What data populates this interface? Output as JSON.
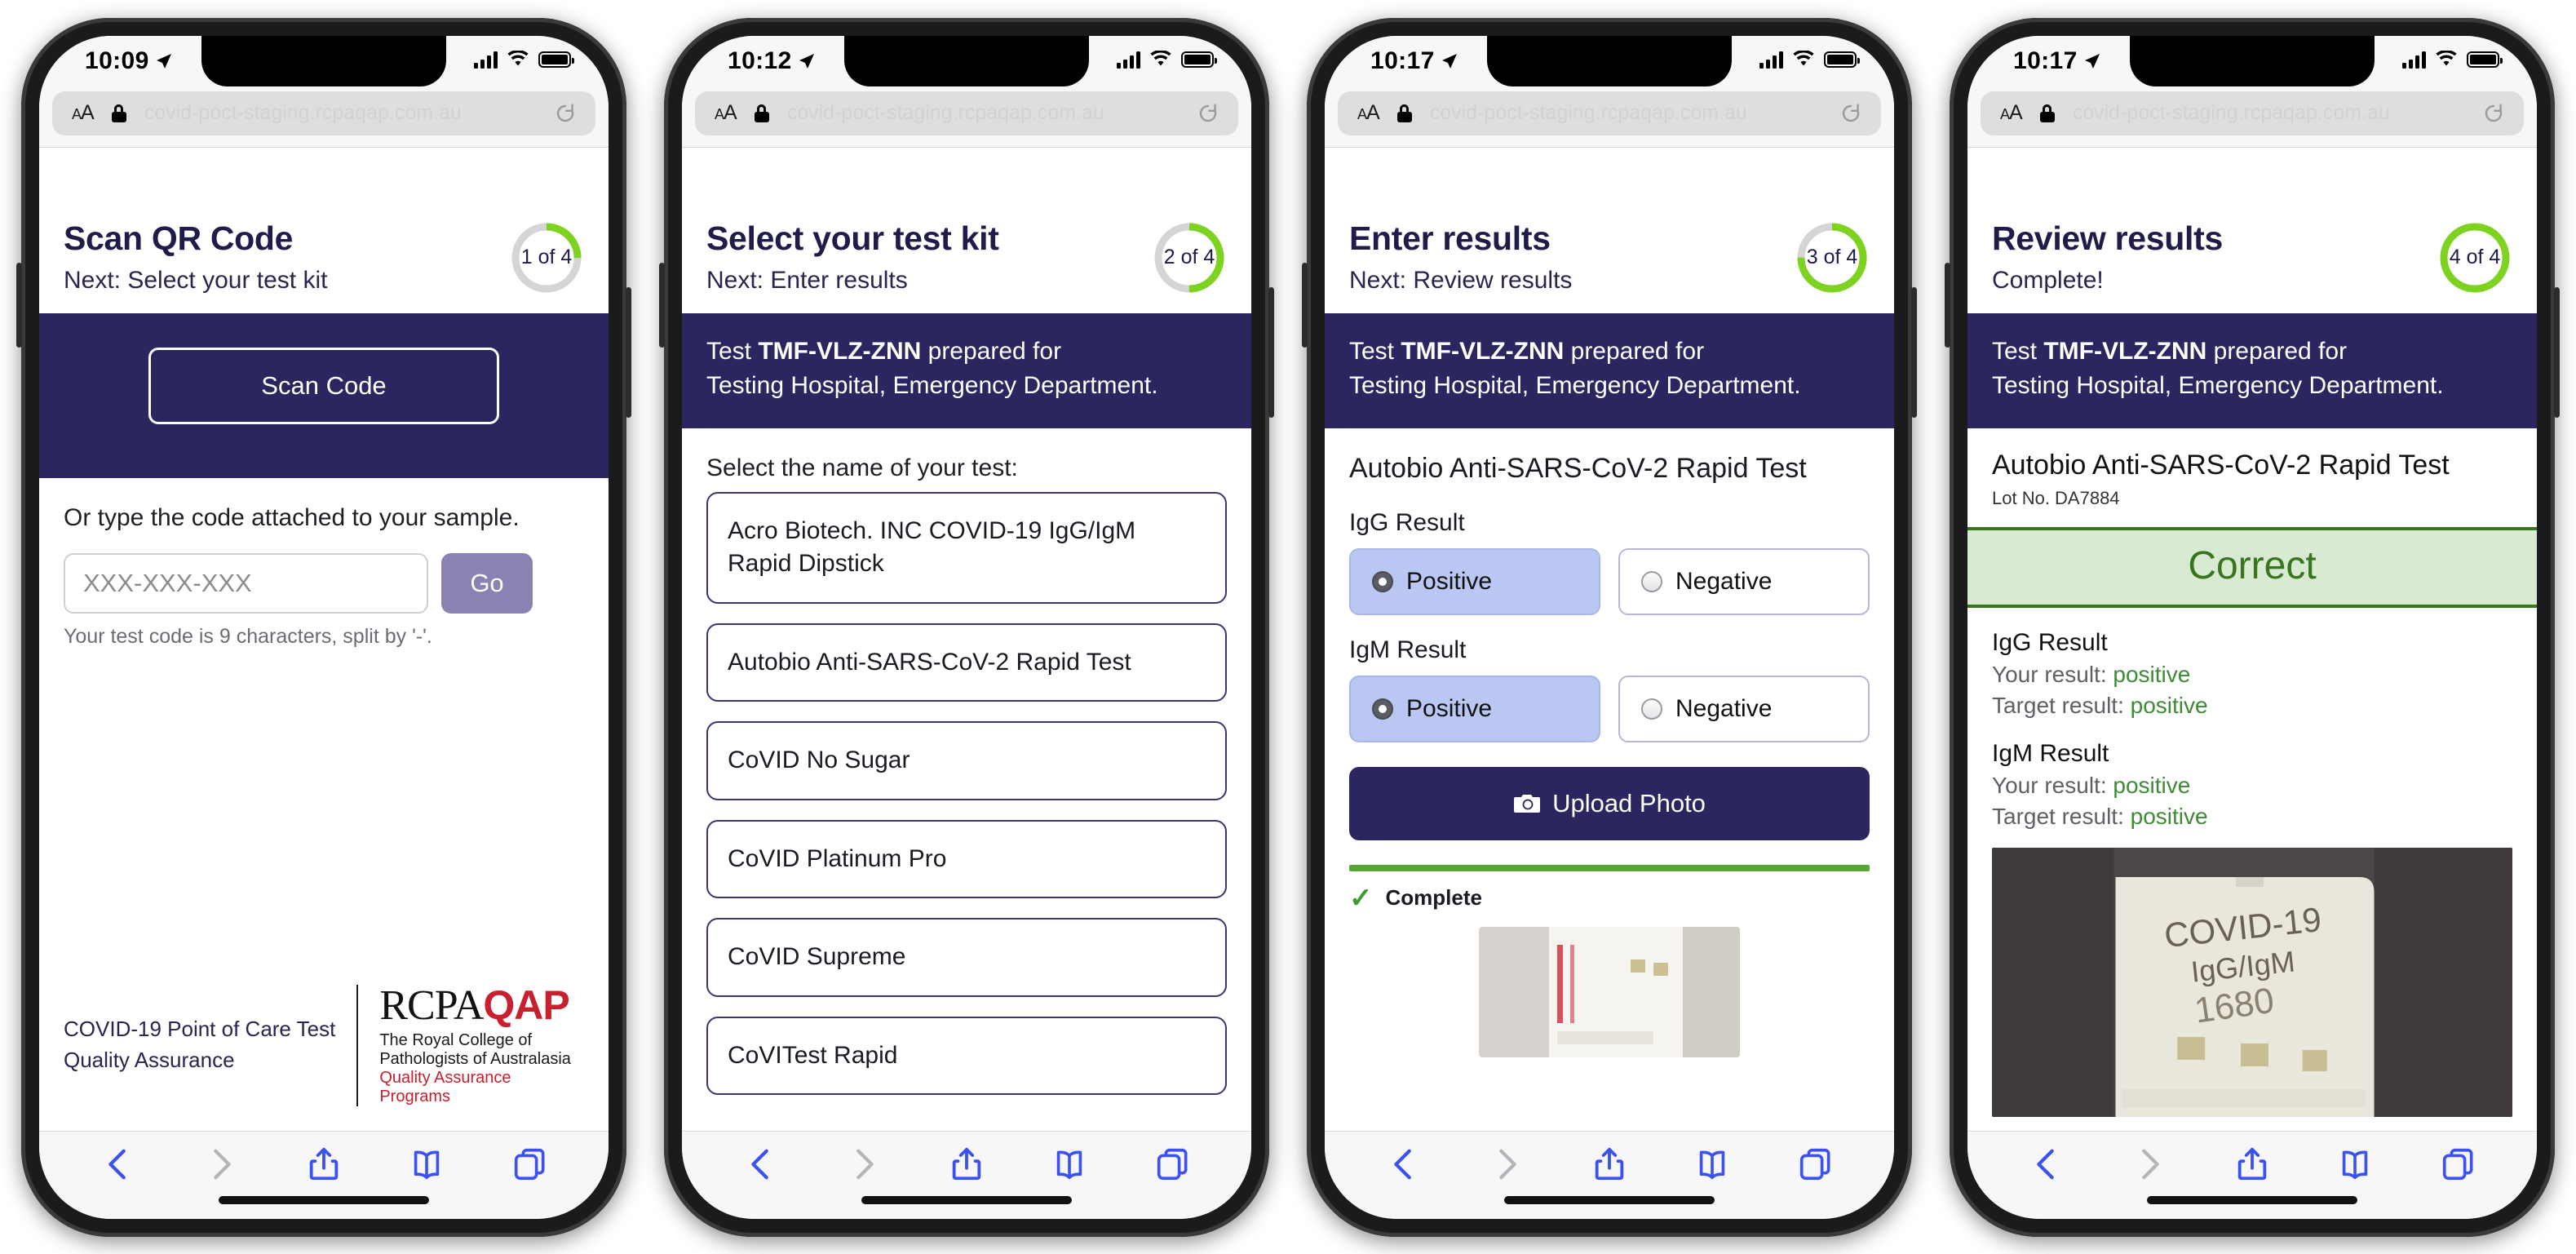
{
  "browser": {
    "url_text": "covid-poct-staging.rcpaqap.com.au",
    "aa_label": "AA",
    "lock_icon": "lock-icon",
    "reload_icon": "reload-icon",
    "toolbar": {
      "back": "back-icon",
      "forward": "forward-icon",
      "share": "share-icon",
      "bookmarks": "bookmarks-icon",
      "tabs": "tabs-icon"
    }
  },
  "phones": [
    {
      "status": {
        "time": "10:09",
        "location_icon": "location-arrow-icon",
        "signal": "cellular-icon",
        "wifi": "wifi-icon",
        "battery": "battery-icon"
      },
      "header": {
        "title": "Scan QR Code",
        "subtitle": "Next: Select your test kit",
        "progress_label": "1 of 4",
        "progress_step": 1,
        "progress_total": 4
      },
      "scan": {
        "button": "Scan Code"
      },
      "manual": {
        "prompt": "Or type the code attached to your sample.",
        "input_placeholder": "XXX-XXX-XXX",
        "input_value": "",
        "go": "Go",
        "hint": "Your test code is 9 characters, split by '-'."
      },
      "footer": {
        "text_line1": "COVID-19 Point of Care Test",
        "text_line2": "Quality Assurance",
        "logo_rcpa": "RCPA",
        "logo_qap": "QAP",
        "logo_line1": "The Royal College of Pathologists of Australasia",
        "logo_line2": "Quality Assurance Programs"
      }
    },
    {
      "status": {
        "time": "10:12"
      },
      "header": {
        "title": "Select your test kit",
        "subtitle": "Next: Enter results",
        "progress_label": "2 of 4",
        "progress_step": 2,
        "progress_total": 4
      },
      "banner": {
        "prefix": "Test ",
        "code": "TMF-VLZ-ZNN",
        "suffix": " prepared for",
        "line2": "Testing Hospital, Emergency Department."
      },
      "prompt": "Select the name of your test:",
      "kits": [
        "Acro Biotech. INC COVID-19 IgG/IgM Rapid Dipstick",
        "Autobio Anti-SARS-CoV-2 Rapid Test",
        "CoVID No Sugar",
        "CoVID Platinum Pro",
        "CoVID Supreme",
        "CoVITest Rapid"
      ]
    },
    {
      "status": {
        "time": "10:17"
      },
      "header": {
        "title": "Enter results",
        "subtitle": "Next: Review results",
        "progress_label": "3 of 4",
        "progress_step": 3,
        "progress_total": 4
      },
      "banner": {
        "prefix": "Test ",
        "code": "TMF-VLZ-ZNN",
        "suffix": " prepared for",
        "line2": "Testing Hospital, Emergency Department."
      },
      "kit_name": "Autobio Anti-SARS-CoV-2 Rapid Test",
      "results": [
        {
          "label": "IgG Result",
          "positive": "Positive",
          "negative": "Negative",
          "selected": "Positive"
        },
        {
          "label": "IgM Result",
          "positive": "Positive",
          "negative": "Negative",
          "selected": "Positive"
        }
      ],
      "upload": {
        "label": "Upload Photo",
        "icon": "camera-icon"
      },
      "upload_status": {
        "label": "Complete",
        "icon": "checkmark-icon",
        "bar_color": "#56a734"
      }
    },
    {
      "status": {
        "time": "10:17"
      },
      "header": {
        "title": "Review results",
        "subtitle": "Complete!",
        "progress_label": "4 of 4",
        "progress_step": 4,
        "progress_total": 4
      },
      "banner": {
        "prefix": "Test ",
        "code": "TMF-VLZ-ZNN",
        "suffix": " prepared for",
        "line2": "Testing Hospital, Emergency Department."
      },
      "kit_name": "Autobio Anti-SARS-CoV-2 Rapid Test",
      "lot": "Lot No. DA7884",
      "verdict": {
        "label": "Correct",
        "color": "#38761d",
        "background": "#d9ead3"
      },
      "review": [
        {
          "heading": "IgG Result",
          "your_label": "Your result: ",
          "your_value": "positive",
          "target_label": "Target result: ",
          "target_value": "positive"
        },
        {
          "heading": "IgM Result",
          "your_label": "Your result: ",
          "your_value": "positive",
          "target_label": "Target result: ",
          "target_value": "positive"
        }
      ],
      "photo": {
        "caption_line1": "COVID-19",
        "caption_line2": "IgG/IgM",
        "caption_line3": "1680"
      }
    }
  ],
  "colors": {
    "brand_navy": "#2b2560",
    "accent_green": "#7ed321",
    "success_green": "#38761d",
    "selected_blue": "#b9c7f2",
    "safari_blue": "#3b52f0",
    "logo_red": "#c8202e"
  }
}
